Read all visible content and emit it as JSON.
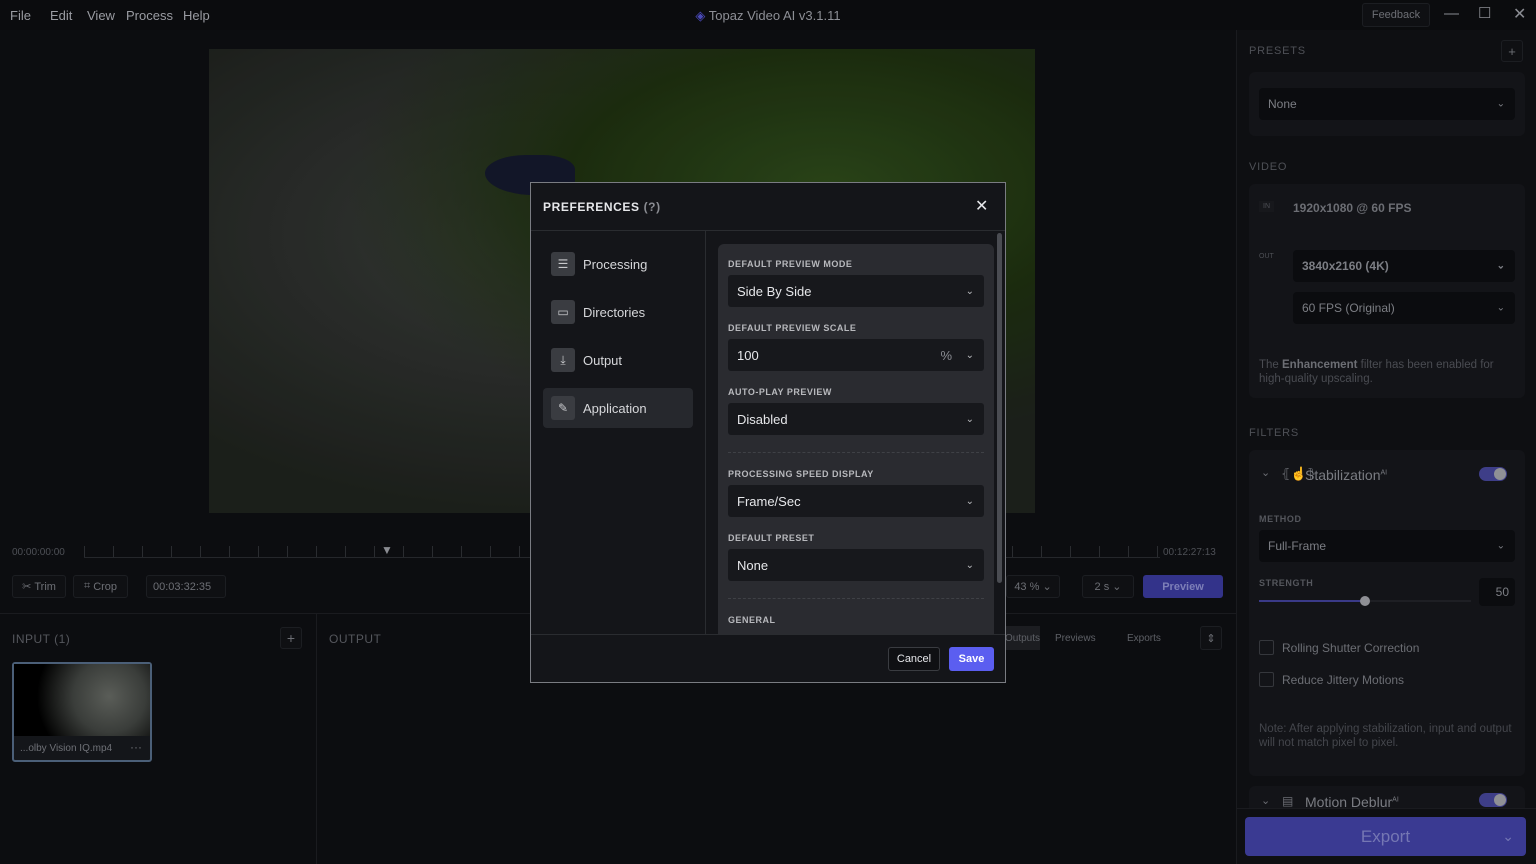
{
  "menu": [
    "File",
    "Edit",
    "View",
    "Process",
    "Help"
  ],
  "app_title": "Topaz Video AI  v3.1.11",
  "feedback": "Feedback",
  "timeline": {
    "start": "00:00:00:00",
    "end": "00:12:27:13",
    "current": "00:03:32:35",
    "trim": "Trim",
    "crop": "Crop",
    "zoom": "43",
    "zoom_unit": "%",
    "step": "2",
    "step_unit": "s",
    "preview": "Preview"
  },
  "input": {
    "title": "INPUT (1)",
    "file": "...olby Vision IQ.mp4"
  },
  "output": {
    "title": "OUTPUT",
    "tabs": [
      "Outputs",
      "Previews",
      "Exports"
    ]
  },
  "right": {
    "presets_label": "PRESETS",
    "preset": "None",
    "video_label": "VIDEO",
    "in": "IN",
    "in_res": "1920x1080 @ 60 FPS",
    "out": "OUT",
    "out_res": "3840x2160 (4K)",
    "out_fps": "60 FPS (Original)",
    "enh_pre": "The ",
    "enh_bold": "Enhancement",
    "enh_post": " filter has been enabled for high-quality upscaling.",
    "filters_label": "FILTERS",
    "stab": "Stabilization",
    "ai": "AI",
    "method_label": "METHOD",
    "method": "Full-Frame",
    "strength_label": "STRENGTH",
    "strength": "50",
    "rolling": "Rolling Shutter Correction",
    "jitter": "Reduce Jittery Motions",
    "note": "Note: After applying stabilization, input and output will not match pixel to pixel.",
    "deblur": "Motion Deblur",
    "export": "Export",
    "accent": "#4a4ab8"
  },
  "dialog": {
    "title": "PREFERENCES",
    "help": "(?)",
    "nav": [
      "Processing",
      "Directories",
      "Output",
      "Application"
    ],
    "active": "Application",
    "fields": {
      "mode_label": "DEFAULT PREVIEW MODE",
      "mode": "Side By Side",
      "scale_label": "DEFAULT PREVIEW SCALE",
      "scale": "100",
      "scale_unit": "%",
      "autoplay_label": "AUTO-PLAY PREVIEW",
      "autoplay": "Disabled",
      "speed_label": "PROCESSING SPEED DISPLAY",
      "speed": "Frame/Sec",
      "preset_label": "DEFAULT PRESET",
      "preset": "None",
      "general_label": "GENERAL"
    },
    "cancel": "Cancel",
    "save": "Save",
    "save_color": "#5b5ef0"
  }
}
